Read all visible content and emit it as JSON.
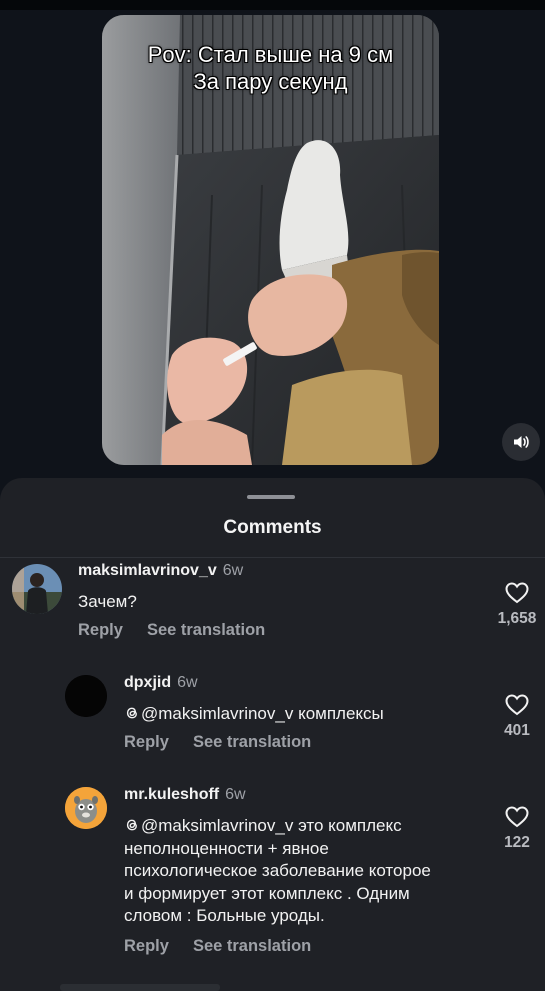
{
  "video": {
    "caption_line1": "Pov: Стал выше на 9 см",
    "caption_line2": "За пару секунд",
    "sound_icon": "speaker-icon"
  },
  "comments_sheet": {
    "title": "Comments",
    "comments": [
      {
        "username": "maksimlavrinov_v",
        "time": "6w",
        "text": "Зачем?",
        "reply": "Reply",
        "translate": "See translation",
        "likes": "1,658"
      },
      {
        "username": "dpxjid",
        "time": "6w",
        "mention": "@maksimlavrinov_v",
        "text": " комплексы",
        "reply": "Reply",
        "translate": "See translation",
        "likes": "401"
      },
      {
        "username": "mr.kuleshoff",
        "time": "6w",
        "mention": "@maksimlavrinov_v",
        "text_line1": " это комплекс",
        "text_line2": "неполноценности + явное",
        "text_line3": "психологическое заболевание которое",
        "text_line4": "и формирует этот комплекс . Одним",
        "text_line5": "словом : Больные уроды.",
        "reply": "Reply",
        "translate": "See translation",
        "likes": "122"
      }
    ]
  },
  "colors": {
    "background": "#0f131a",
    "sheet": "#1f2126",
    "secondary_text": "#9ea1a7"
  }
}
